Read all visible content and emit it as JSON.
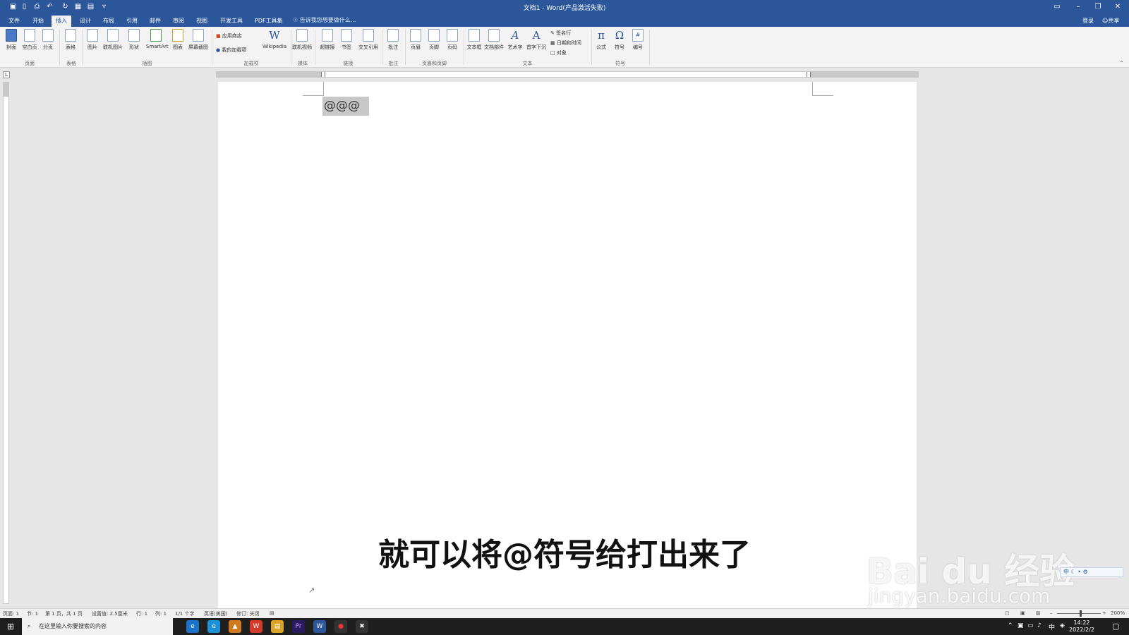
{
  "titlebar": {
    "title": "文档1 - Word(产品激活失败)",
    "quick_access": [
      "save-icon",
      "new-doc-icon",
      "print-preview-icon",
      "undo-icon",
      "redo-icon",
      "table-icon",
      "open-icon",
      "customize-icon"
    ],
    "window_controls": [
      "ribbon-display-icon",
      "minimize-icon",
      "restore-icon",
      "close-icon"
    ]
  },
  "tabs": [
    {
      "label": "文件"
    },
    {
      "label": "开始"
    },
    {
      "label": "插入",
      "active": true
    },
    {
      "label": "设计"
    },
    {
      "label": "布局"
    },
    {
      "label": "引用"
    },
    {
      "label": "邮件"
    },
    {
      "label": "审阅"
    },
    {
      "label": "视图"
    },
    {
      "label": "开发工具"
    },
    {
      "label": "PDF工具集"
    }
  ],
  "tell_me": "告诉我您想要做什么...",
  "account": {
    "login": "登录",
    "share": "共享"
  },
  "ribbon": {
    "buttons": [
      {
        "label": "封面"
      },
      {
        "label": "空白页"
      },
      {
        "label": "分页"
      },
      {
        "label": "表格"
      },
      {
        "label": "图片"
      },
      {
        "label": "联机图片"
      },
      {
        "label": "形状"
      },
      {
        "label": "SmartArt"
      },
      {
        "label": "图表"
      },
      {
        "label": "屏幕截图"
      },
      {
        "label": "Wikipedia"
      },
      {
        "label": "联机视频"
      },
      {
        "label": "超链接"
      },
      {
        "label": "书签"
      },
      {
        "label": "交叉引用"
      },
      {
        "label": "批注"
      },
      {
        "label": "页眉"
      },
      {
        "label": "页脚"
      },
      {
        "label": "页码"
      },
      {
        "label": "文本框"
      },
      {
        "label": "文档部件"
      },
      {
        "label": "艺术字"
      },
      {
        "label": "首字下沉"
      },
      {
        "label": "公式"
      },
      {
        "label": "符号"
      },
      {
        "label": "编号"
      }
    ],
    "small": {
      "store": "应用商店",
      "my_addins": "我的加载项",
      "signature": "签名行",
      "datetime": "日期和时间",
      "object": "对象"
    },
    "groups": [
      "页面",
      "表格",
      "插图",
      "加载项",
      "媒体",
      "链接",
      "批注",
      "页眉和页脚",
      "文本",
      "符号"
    ]
  },
  "document": {
    "typed_text": "@@@"
  },
  "caption": "就可以将@符号给打出来了",
  "watermark": {
    "brand": "Bai du 经验",
    "url": "jingyan.baidu.com"
  },
  "statusbar": {
    "page": "页面: 1",
    "section": "节: 1",
    "page_of": "第 1 页，共 1 页",
    "position": "设置值: 2.5厘米",
    "line": "行: 1",
    "column": "列: 1",
    "words": "1/1 个字",
    "language": "英语(美国)",
    "track": "修订: 关闭",
    "zoom": "200%"
  },
  "taskbar": {
    "search_placeholder": "在这里输入你要搜索的内容",
    "time": "14:22",
    "date": "2022/2/2",
    "ime": "中"
  }
}
